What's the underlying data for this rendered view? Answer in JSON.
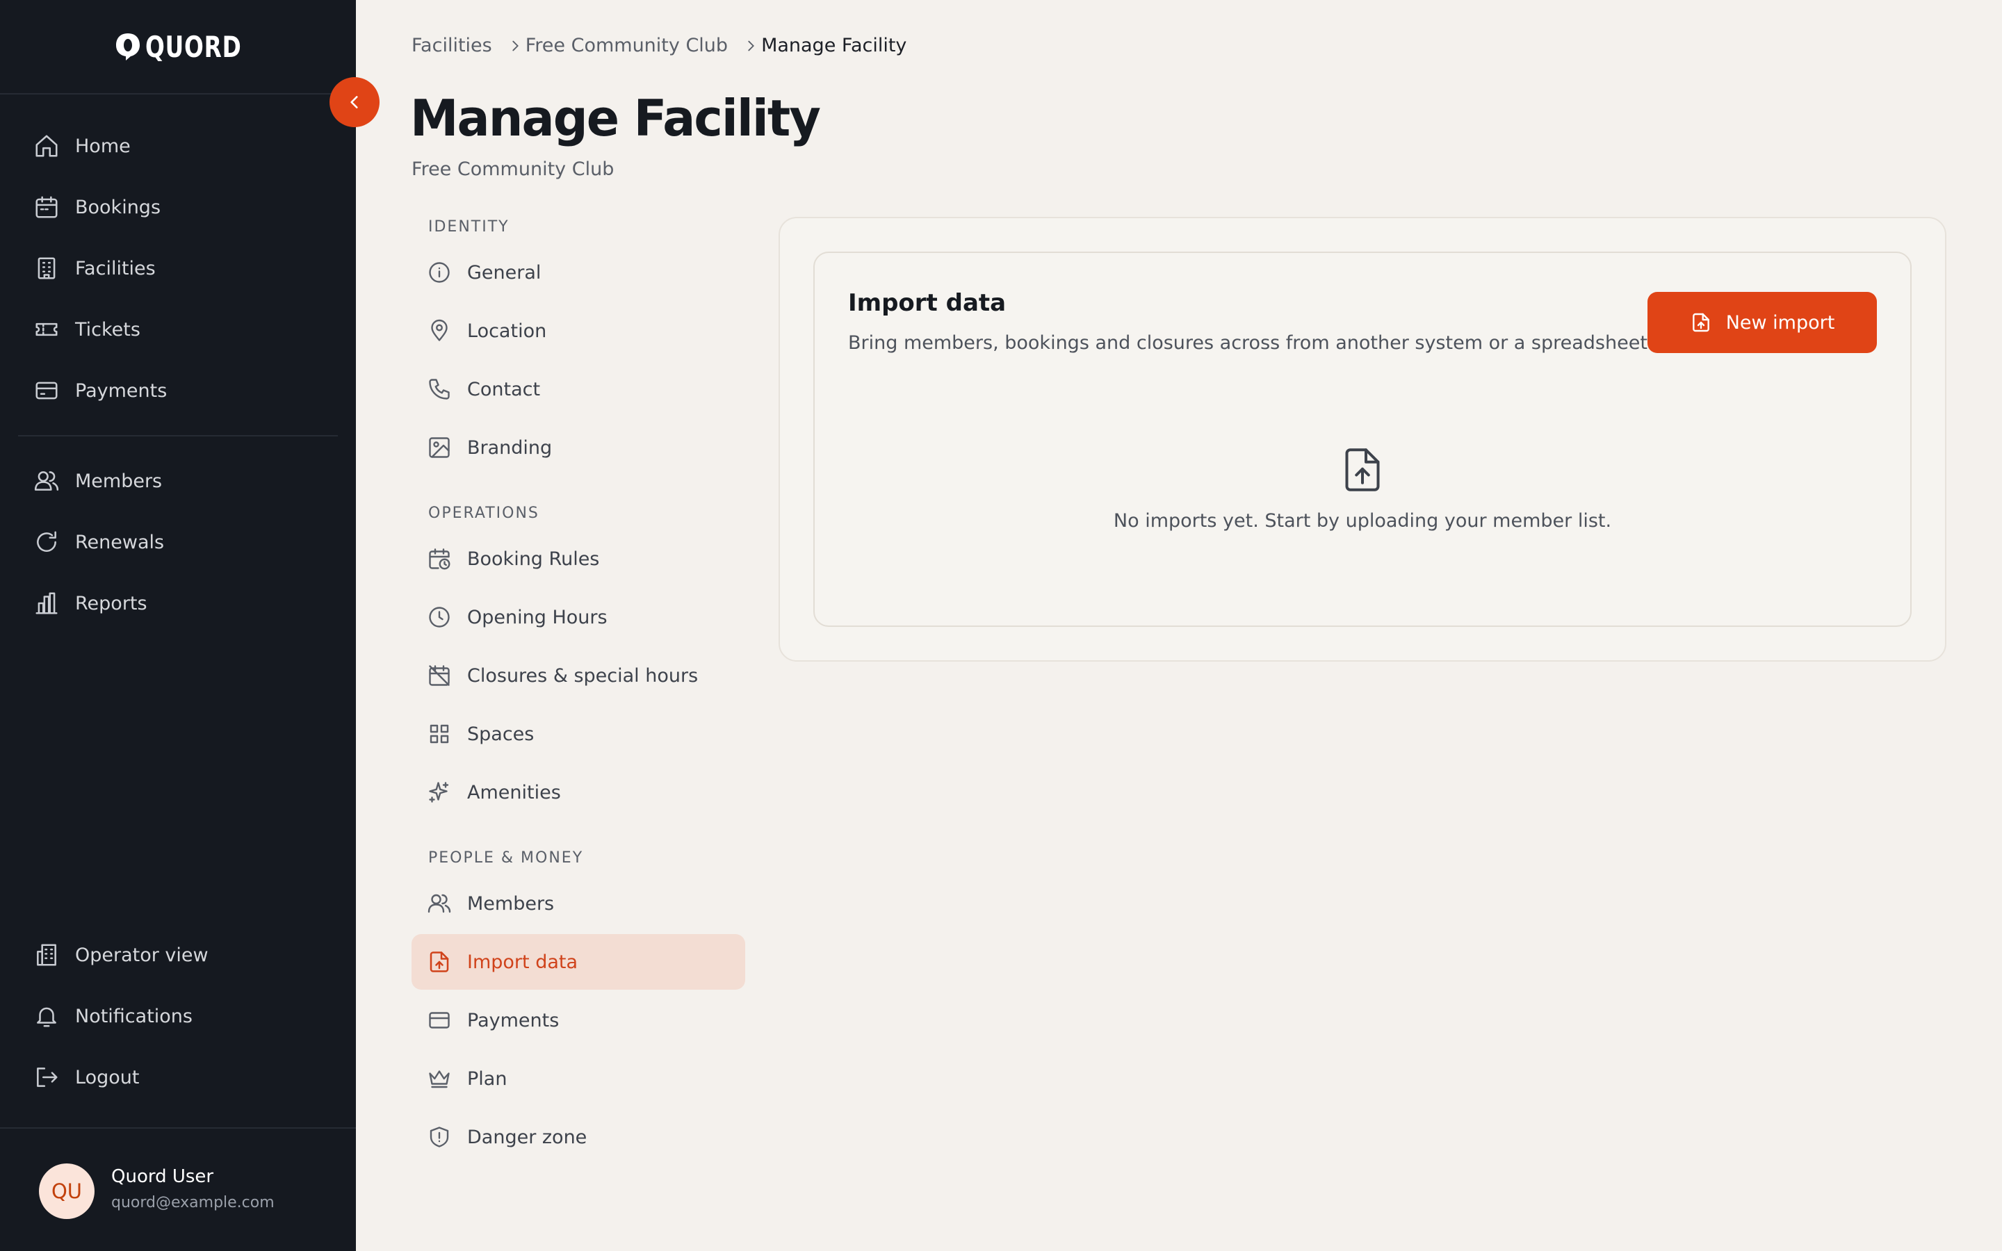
{
  "brand": {
    "name": "QUORD",
    "logo_icon": "quord-logo-icon"
  },
  "sidebar": {
    "collapse_icon": "chevron-left-icon",
    "primary": [
      {
        "label": "Home",
        "icon": "home-icon"
      },
      {
        "label": "Bookings",
        "icon": "calendar-icon"
      },
      {
        "label": "Facilities",
        "icon": "building-icon"
      },
      {
        "label": "Tickets",
        "icon": "ticket-icon"
      },
      {
        "label": "Payments",
        "icon": "credit-card-icon"
      }
    ],
    "secondary": [
      {
        "label": "Members",
        "icon": "users-icon"
      },
      {
        "label": "Renewals",
        "icon": "refresh-icon"
      },
      {
        "label": "Reports",
        "icon": "bar-chart-icon"
      }
    ],
    "bottom": [
      {
        "label": "Operator view",
        "icon": "office-building-icon"
      },
      {
        "label": "Notifications",
        "icon": "bell-icon"
      },
      {
        "label": "Logout",
        "icon": "logout-icon"
      }
    ],
    "user": {
      "initials": "QU",
      "name": "Quord User",
      "email": "quord@example.com"
    }
  },
  "breadcrumb": {
    "items": [
      "Facilities",
      "Free Community Club"
    ],
    "current": "Manage Facility"
  },
  "page": {
    "title": "Manage Facility",
    "subtitle": "Free Community Club"
  },
  "subnav": {
    "sections": [
      {
        "heading": "IDENTITY",
        "items": [
          {
            "label": "General",
            "icon": "info-icon"
          },
          {
            "label": "Location",
            "icon": "map-pin-icon"
          },
          {
            "label": "Contact",
            "icon": "phone-icon"
          },
          {
            "label": "Branding",
            "icon": "image-icon"
          }
        ]
      },
      {
        "heading": "OPERATIONS",
        "items": [
          {
            "label": "Booking Rules",
            "icon": "calendar-clock-icon"
          },
          {
            "label": "Opening Hours",
            "icon": "clock-icon"
          },
          {
            "label": "Closures & special hours",
            "icon": "calendar-off-icon"
          },
          {
            "label": "Spaces",
            "icon": "grid-icon"
          },
          {
            "label": "Amenities",
            "icon": "sparkles-icon"
          }
        ]
      },
      {
        "heading": "PEOPLE & MONEY",
        "items": [
          {
            "label": "Members",
            "icon": "users-icon"
          },
          {
            "label": "Import data",
            "icon": "file-upload-icon",
            "active": true
          },
          {
            "label": "Payments",
            "icon": "credit-card-icon"
          },
          {
            "label": "Plan",
            "icon": "crown-icon"
          },
          {
            "label": "Danger zone",
            "icon": "shield-alert-icon"
          }
        ]
      }
    ]
  },
  "import_card": {
    "title": "Import data",
    "description": "Bring members, bookings and closures across from another system or a spreadsheet.",
    "button_label": "New import",
    "button_icon": "file-upload-icon",
    "empty_icon": "file-upload-icon",
    "empty_text": "No imports yet. Start by uploading your member list."
  },
  "colors": {
    "accent": "#e04416",
    "sidebar_bg": "#151920",
    "page_bg": "#f4f1ed",
    "active_bg": "#f3ddd3"
  }
}
